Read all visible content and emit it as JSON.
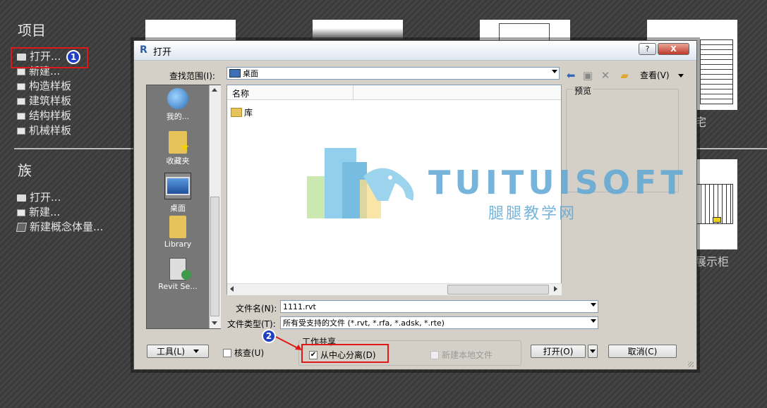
{
  "background": {
    "project_title": "项目",
    "project_items": [
      "打开...",
      "新建...",
      "构造样板",
      "建筑样板",
      "结构样板",
      "机械样板"
    ],
    "family_title": "族",
    "family_items": [
      "打开...",
      "新建...",
      "新建概念体量..."
    ],
    "thumb_labels": [
      "宅",
      "展示柜"
    ]
  },
  "annotations": {
    "step1": "1",
    "step2": "2"
  },
  "dialog": {
    "title": "打开",
    "help": "?",
    "close": "X",
    "look_in_label": "查找范围(I):",
    "look_in_value": "桌面",
    "views_label": "查看(V)",
    "places": [
      {
        "label": "我的...",
        "icon": "computer-icon"
      },
      {
        "label": "收藏夹",
        "icon": "favorites-folder-icon"
      },
      {
        "label": "桌面",
        "icon": "desktop-icon"
      },
      {
        "label": "Library",
        "icon": "folder-icon"
      },
      {
        "label": "Revit Se...",
        "icon": "revit-server-icon"
      }
    ],
    "column_name": "名称",
    "files": [
      {
        "name": "库",
        "icon": "folder-icon"
      }
    ],
    "preview_label": "预览",
    "filename_label": "文件名(N):",
    "filename_value": "1111.rvt",
    "filetype_label": "文件类型(T):",
    "filetype_value": "所有受支持的文件 (*.rvt, *.rfa, *.adsk, *.rte)",
    "tools_label": "工具(L)",
    "audit_label": "核查(U)",
    "worksharing_label": "工作共享",
    "detach_label": "从中心分离(D)",
    "new_local_label": "新建本地文件",
    "open_label": "打开(O)",
    "cancel_label": "取消(C)"
  },
  "watermark": {
    "brand": "TUITUISOFT",
    "sub": "腿腿教学网"
  },
  "colors": {
    "red_highlight": "#e01818",
    "badge_blue": "#1f3fc4",
    "watermark_blue": "#5fa7d6"
  }
}
